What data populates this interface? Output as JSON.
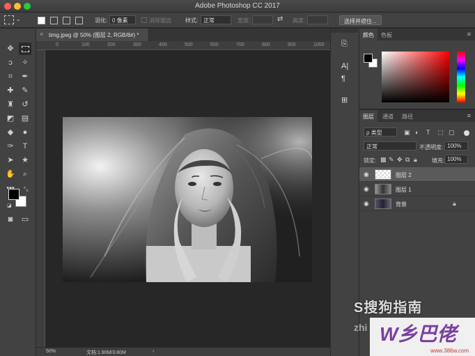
{
  "app": {
    "title": "Adobe Photoshop CC 2017"
  },
  "options": {
    "feather_label": "羽化:",
    "feather_value": "0 像素",
    "antialias_label": "消除锯齿",
    "style_label": "样式:",
    "style_value": "正常",
    "width_label": "宽度:",
    "height_label": "高度:",
    "select_mask_button": "选择并遮住..."
  },
  "document": {
    "tab_label": "timg.jpeg @ 50% (图层 2, RGB/8#) *",
    "zoom": "50%",
    "doc_size": "文档:1.90M/3.80M"
  },
  "ruler": {
    "ticks": [
      "0",
      "50",
      "100",
      "150",
      "200",
      "250",
      "300",
      "350",
      "400",
      "450",
      "500",
      "550",
      "600",
      "650",
      "700",
      "750",
      "800",
      "850",
      "900",
      "950",
      "1000"
    ]
  },
  "color_panel": {
    "tabs": [
      "颜色",
      "色板"
    ]
  },
  "layers_panel": {
    "tabs": [
      "图层",
      "通道",
      "路径"
    ],
    "filter_label": "ρ 类型",
    "blend_mode": "正常",
    "opacity_label": "不透明度:",
    "opacity_value": "100%",
    "lock_label": "锁定:",
    "fill_label": "填充:",
    "fill_value": "100%",
    "layers": [
      {
        "name": "图层 2",
        "selected": true
      },
      {
        "name": "图层 1",
        "selected": false
      },
      {
        "name": "背景",
        "selected": false,
        "locked": true
      }
    ]
  },
  "watermark": {
    "sogou": "S搜狗指南",
    "zhi": "zhi",
    "brand": "W乡巴佬",
    "url": "www.386w.com"
  },
  "colors": {
    "accent": "#7a3fa0"
  }
}
